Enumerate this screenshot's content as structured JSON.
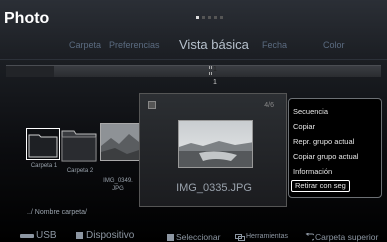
{
  "header": {
    "title": "Photo",
    "page_dots": 5,
    "active_dot": 1
  },
  "tabs": [
    {
      "label": "Carpeta",
      "active": false
    },
    {
      "label": "Preferencias",
      "active": false
    },
    {
      "label": "Vista básica",
      "active": true
    },
    {
      "label": "Fecha",
      "active": false
    },
    {
      "label": "Color",
      "active": false
    }
  ],
  "timeline": {
    "marker_top": "1",
    "marker_bottom": "1"
  },
  "thumbnails": [
    {
      "caption": "Carpeta 1"
    },
    {
      "caption": "Carpeta 2"
    },
    {
      "caption": "IMG_0349.\nJPG"
    }
  ],
  "preview": {
    "count": "4/6",
    "filename": "IMG_0335.JPG"
  },
  "context_menu": {
    "items": [
      {
        "label": "Secuencia"
      },
      {
        "label": "Copiar"
      },
      {
        "label": "Repr. grupo actual"
      },
      {
        "label": "Copiar grupo actual"
      },
      {
        "label": "Información"
      },
      {
        "label": "Retirar con seg"
      }
    ],
    "selected_index": 5
  },
  "breadcrumb": "../ Nombre carpeta/",
  "bottom_bar": {
    "usb": "USB",
    "device": "Dispositivo",
    "select": "Seleccionar",
    "tools": "Herramientas",
    "up_folder": "Carpeta superior"
  },
  "colors": {
    "accent": "#b6c0cc",
    "inactive": "#5b6b80"
  }
}
